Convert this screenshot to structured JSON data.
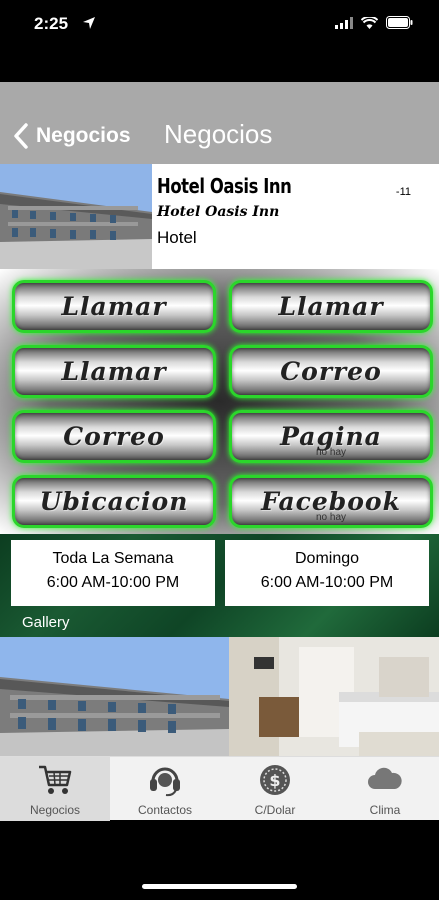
{
  "status_bar": {
    "time": "2:25"
  },
  "nav": {
    "back_label": "Negocios",
    "title": "Negocios"
  },
  "business": {
    "name": "Hotel Oasis Inn",
    "subtitle": "Hotel Oasis Inn",
    "type": "Hotel",
    "code": "-11"
  },
  "actions": [
    {
      "label": "Llamar",
      "sub": ""
    },
    {
      "label": "Llamar",
      "sub": ""
    },
    {
      "label": "Llamar",
      "sub": ""
    },
    {
      "label": "Correo",
      "sub": ""
    },
    {
      "label": "Correo",
      "sub": ""
    },
    {
      "label": "Pagina",
      "sub": "no hay"
    },
    {
      "label": "Ubicacion",
      "sub": ""
    },
    {
      "label": "Facebook",
      "sub": "no hay"
    }
  ],
  "hours": [
    {
      "day": "Toda La Semana",
      "time": "6:00 AM-10:00 PM"
    },
    {
      "day": "Domingo",
      "time": "6:00 AM-10:00 PM"
    }
  ],
  "gallery": {
    "label": "Gallery"
  },
  "tabs": [
    {
      "label": "Negocios",
      "icon": "cart-icon",
      "active": true
    },
    {
      "label": "Contactos",
      "icon": "headset-icon",
      "active": false
    },
    {
      "label": "C/Dolar",
      "icon": "coin-icon",
      "active": false
    },
    {
      "label": "Clima",
      "icon": "cloud-icon",
      "active": false
    }
  ],
  "colors": {
    "accent_green": "#2bd62b",
    "nav_gray": "#a9a9a9",
    "hours_bg": "#1a5a33"
  }
}
